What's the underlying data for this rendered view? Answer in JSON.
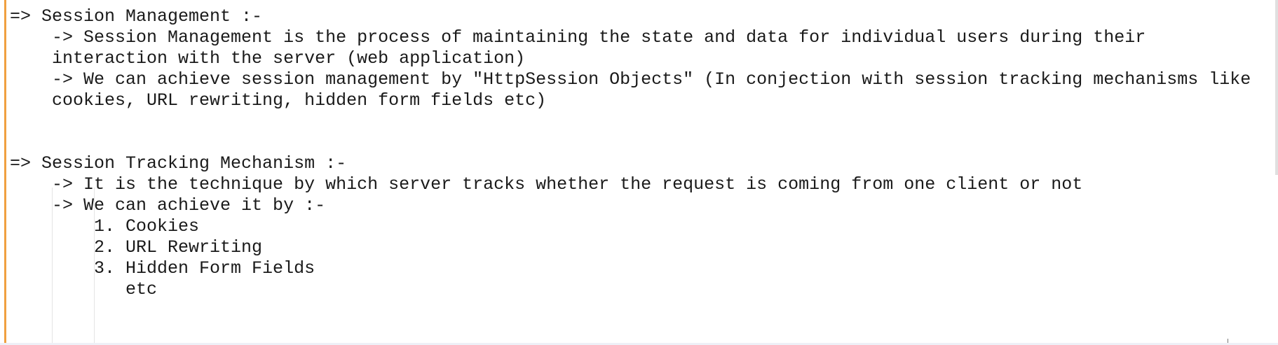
{
  "editor": {
    "lines": [
      "=> Session Management :-",
      "    -> Session Management is the process of maintaining the state and data for individual users during their",
      "    interaction with the server (web application)",
      "    -> We can achieve session management by \"HttpSession Objects\" (In conjection with session tracking mechanisms like",
      "    cookies, URL rewriting, hidden form fields etc)",
      "",
      "",
      "=> Session Tracking Mechanism :-",
      "    -> It is the technique by which server tracks whether the request is coming from one client or not",
      "    -> We can achieve it by :-",
      "        1. Cookies",
      "        2. URL Rewriting",
      "        3. Hidden Form Fields",
      "           etc"
    ]
  },
  "colors": {
    "margin_bar": "#f0a040",
    "text": "#1a1a1a",
    "background": "#ffffff"
  }
}
